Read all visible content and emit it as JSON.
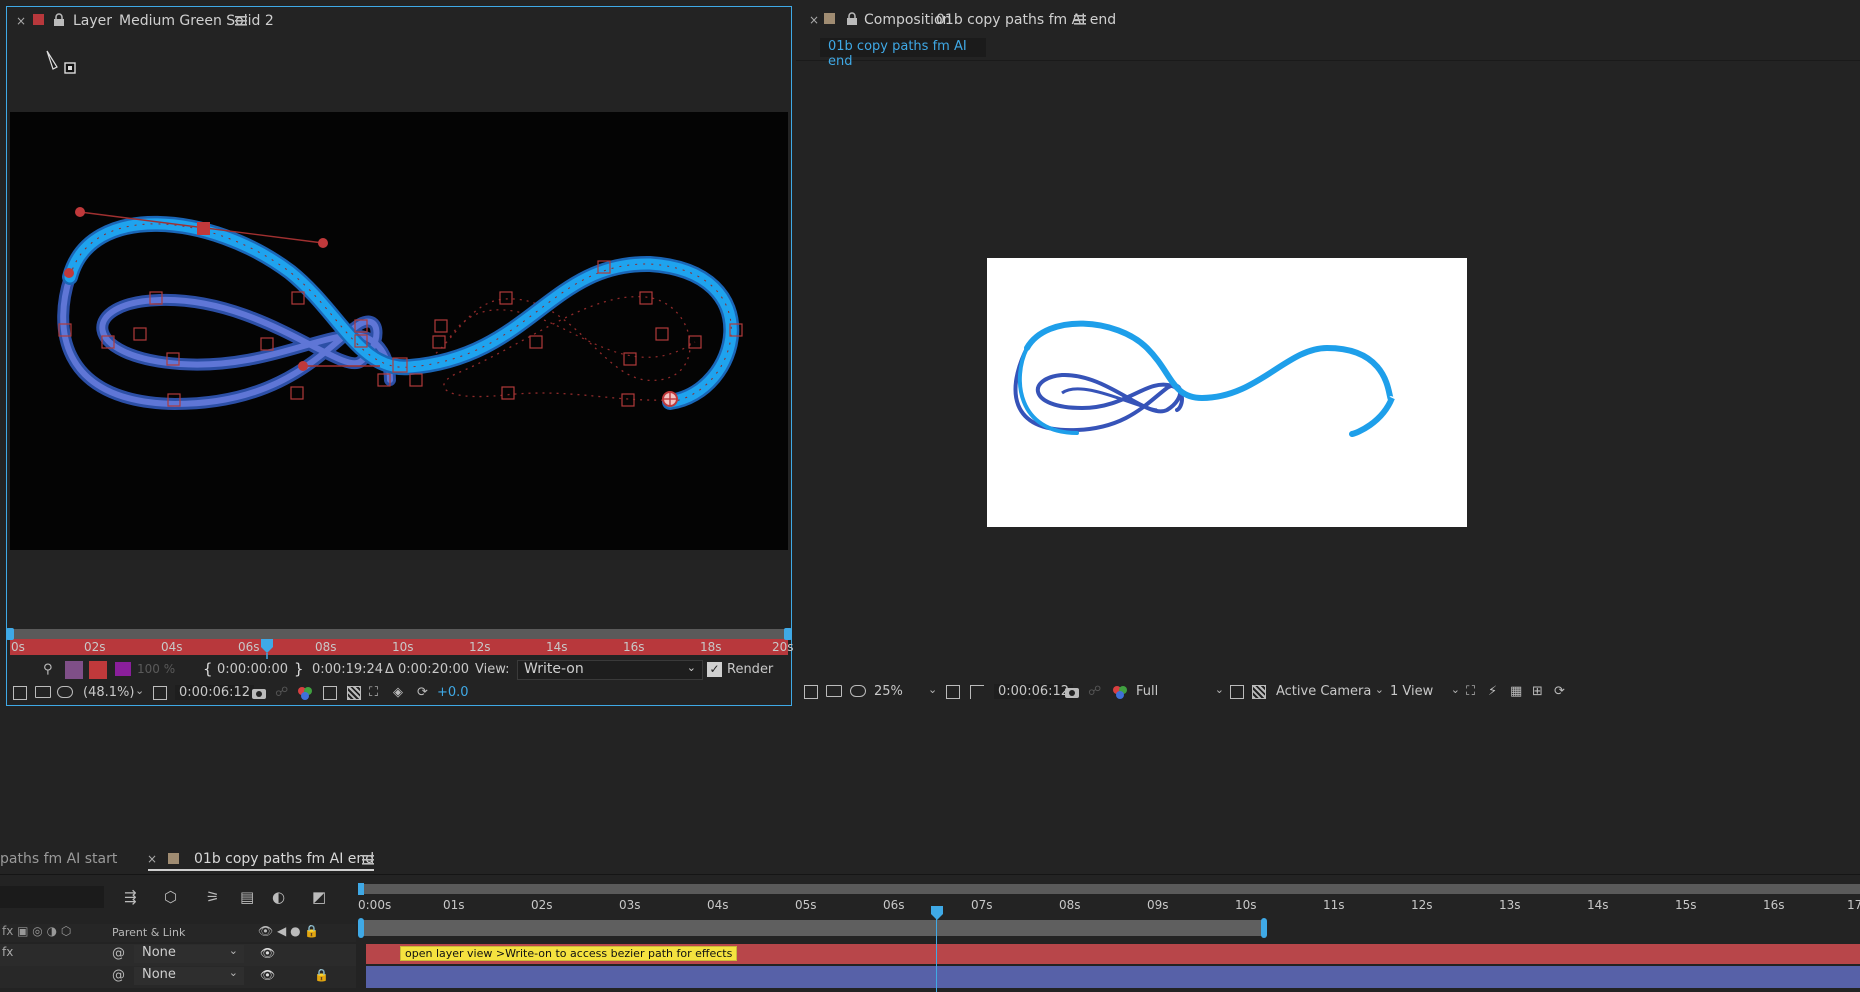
{
  "layer_panel": {
    "tab_kind": "Layer",
    "tab_name": "Medium Green Solid 2",
    "ruler_ticks": [
      "0s",
      "02s",
      "04s",
      "06s",
      "08s",
      "10s",
      "12s",
      "14s",
      "16s",
      "18s",
      "20s"
    ],
    "in_time": "0:00:00:00",
    "out_time": "0:00:19:24",
    "duration": "Δ 0:00:20:00",
    "view_label": "View:",
    "view_value": "Write-on",
    "render_label": "Render",
    "render_checked": true,
    "opacity": "100 %",
    "zoom": "(48.1%)",
    "timecode": "0:00:06:12",
    "exposure": "+0.0"
  },
  "comp_panel": {
    "tab_kind": "Composition",
    "tab_name": "01b copy paths fm AI end",
    "breadcrumb": "01b copy paths fm AI end",
    "zoom": "25%",
    "timecode": "0:00:06:12",
    "resolution": "Full",
    "camera": "Active Camera",
    "views": "1 View"
  },
  "timeline": {
    "tabs": [
      {
        "label": "paths fm AI start",
        "active": false
      },
      {
        "label": "01b copy paths fm AI end",
        "active": true
      }
    ],
    "ruler_ticks": [
      "0:00s",
      "01s",
      "02s",
      "03s",
      "04s",
      "05s",
      "06s",
      "07s",
      "08s",
      "09s",
      "10s",
      "11s",
      "12s",
      "13s",
      "14s",
      "15s",
      "16s",
      "17"
    ],
    "column_header": "Parent & Link",
    "layers": [
      {
        "parent": "None",
        "bar_color": "#b8464a",
        "marker_comment": "open layer view >Write-on to access bezier path for effects"
      },
      {
        "parent": "None",
        "bar_color": "#5761a8",
        "marker_comment": ""
      }
    ]
  }
}
